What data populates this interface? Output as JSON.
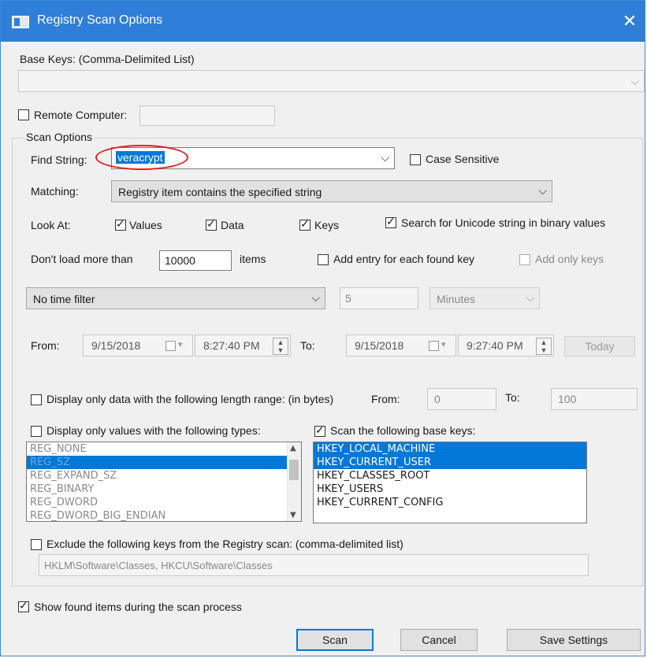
{
  "window": {
    "title": "Registry Scan Options",
    "close_glyph": "✕"
  },
  "base_keys": {
    "label": "Base Keys:  (Comma-Delimited List)",
    "value": ""
  },
  "remote": {
    "label": "Remote Computer:",
    "checked": false,
    "value": ""
  },
  "scan_options": {
    "group_label": "Scan Options",
    "find_label": "Find String:",
    "find_value": "veracrypt",
    "case_label": "Case Sensitive",
    "matching_label": "Matching:",
    "matching_value": "Registry item contains the specified string",
    "look_at_label": "Look At:",
    "values_label": "Values",
    "data_label": "Data",
    "keys_label": "Keys",
    "unicode_label": "Search for Unicode string in binary values",
    "dontload_label": "Don't load more than",
    "dontload_value": "10000",
    "items_label": "items",
    "add_entry_label": "Add entry for each found key",
    "add_only_label": "Add only keys",
    "time_filter_value": "No time filter",
    "time_amount": "5",
    "time_unit": "Minutes",
    "from_label": "From:",
    "from_date": "9/15/2018",
    "from_time": "8:27:40 PM",
    "to_label": "To:",
    "to_date": "9/15/2018",
    "to_time": "9:27:40 PM",
    "today_label": "Today",
    "length_label": "Display only data with the following length range: (in bytes)",
    "length_from_label": "From:",
    "length_from": "0",
    "length_to_label": "To:",
    "length_to": "100",
    "types_label": "Display only values with the following types:",
    "types": [
      "REG_NONE",
      "REG_SZ",
      "REG_EXPAND_SZ",
      "REG_BINARY",
      "REG_DWORD",
      "REG_DWORD_BIG_ENDIAN"
    ],
    "basekeys_label": "Scan the following base keys:",
    "basekeys": [
      "HKEY_LOCAL_MACHINE",
      "HKEY_CURRENT_USER",
      "HKEY_CLASSES_ROOT",
      "HKEY_USERS",
      "HKEY_CURRENT_CONFIG"
    ],
    "exclude_label": "Exclude the following keys from the Registry scan: (comma-delimited list)",
    "exclude_value": "HKLM\\Software\\Classes, HKCU\\Software\\Classes"
  },
  "show_found_label": "Show found items during the scan process",
  "buttons": {
    "scan": "Scan",
    "cancel": "Cancel",
    "save": "Save Settings"
  },
  "colors": {
    "title_bar": "#2f7ed8",
    "selection": "#0078d7",
    "highlight_circle": "#e02020"
  }
}
